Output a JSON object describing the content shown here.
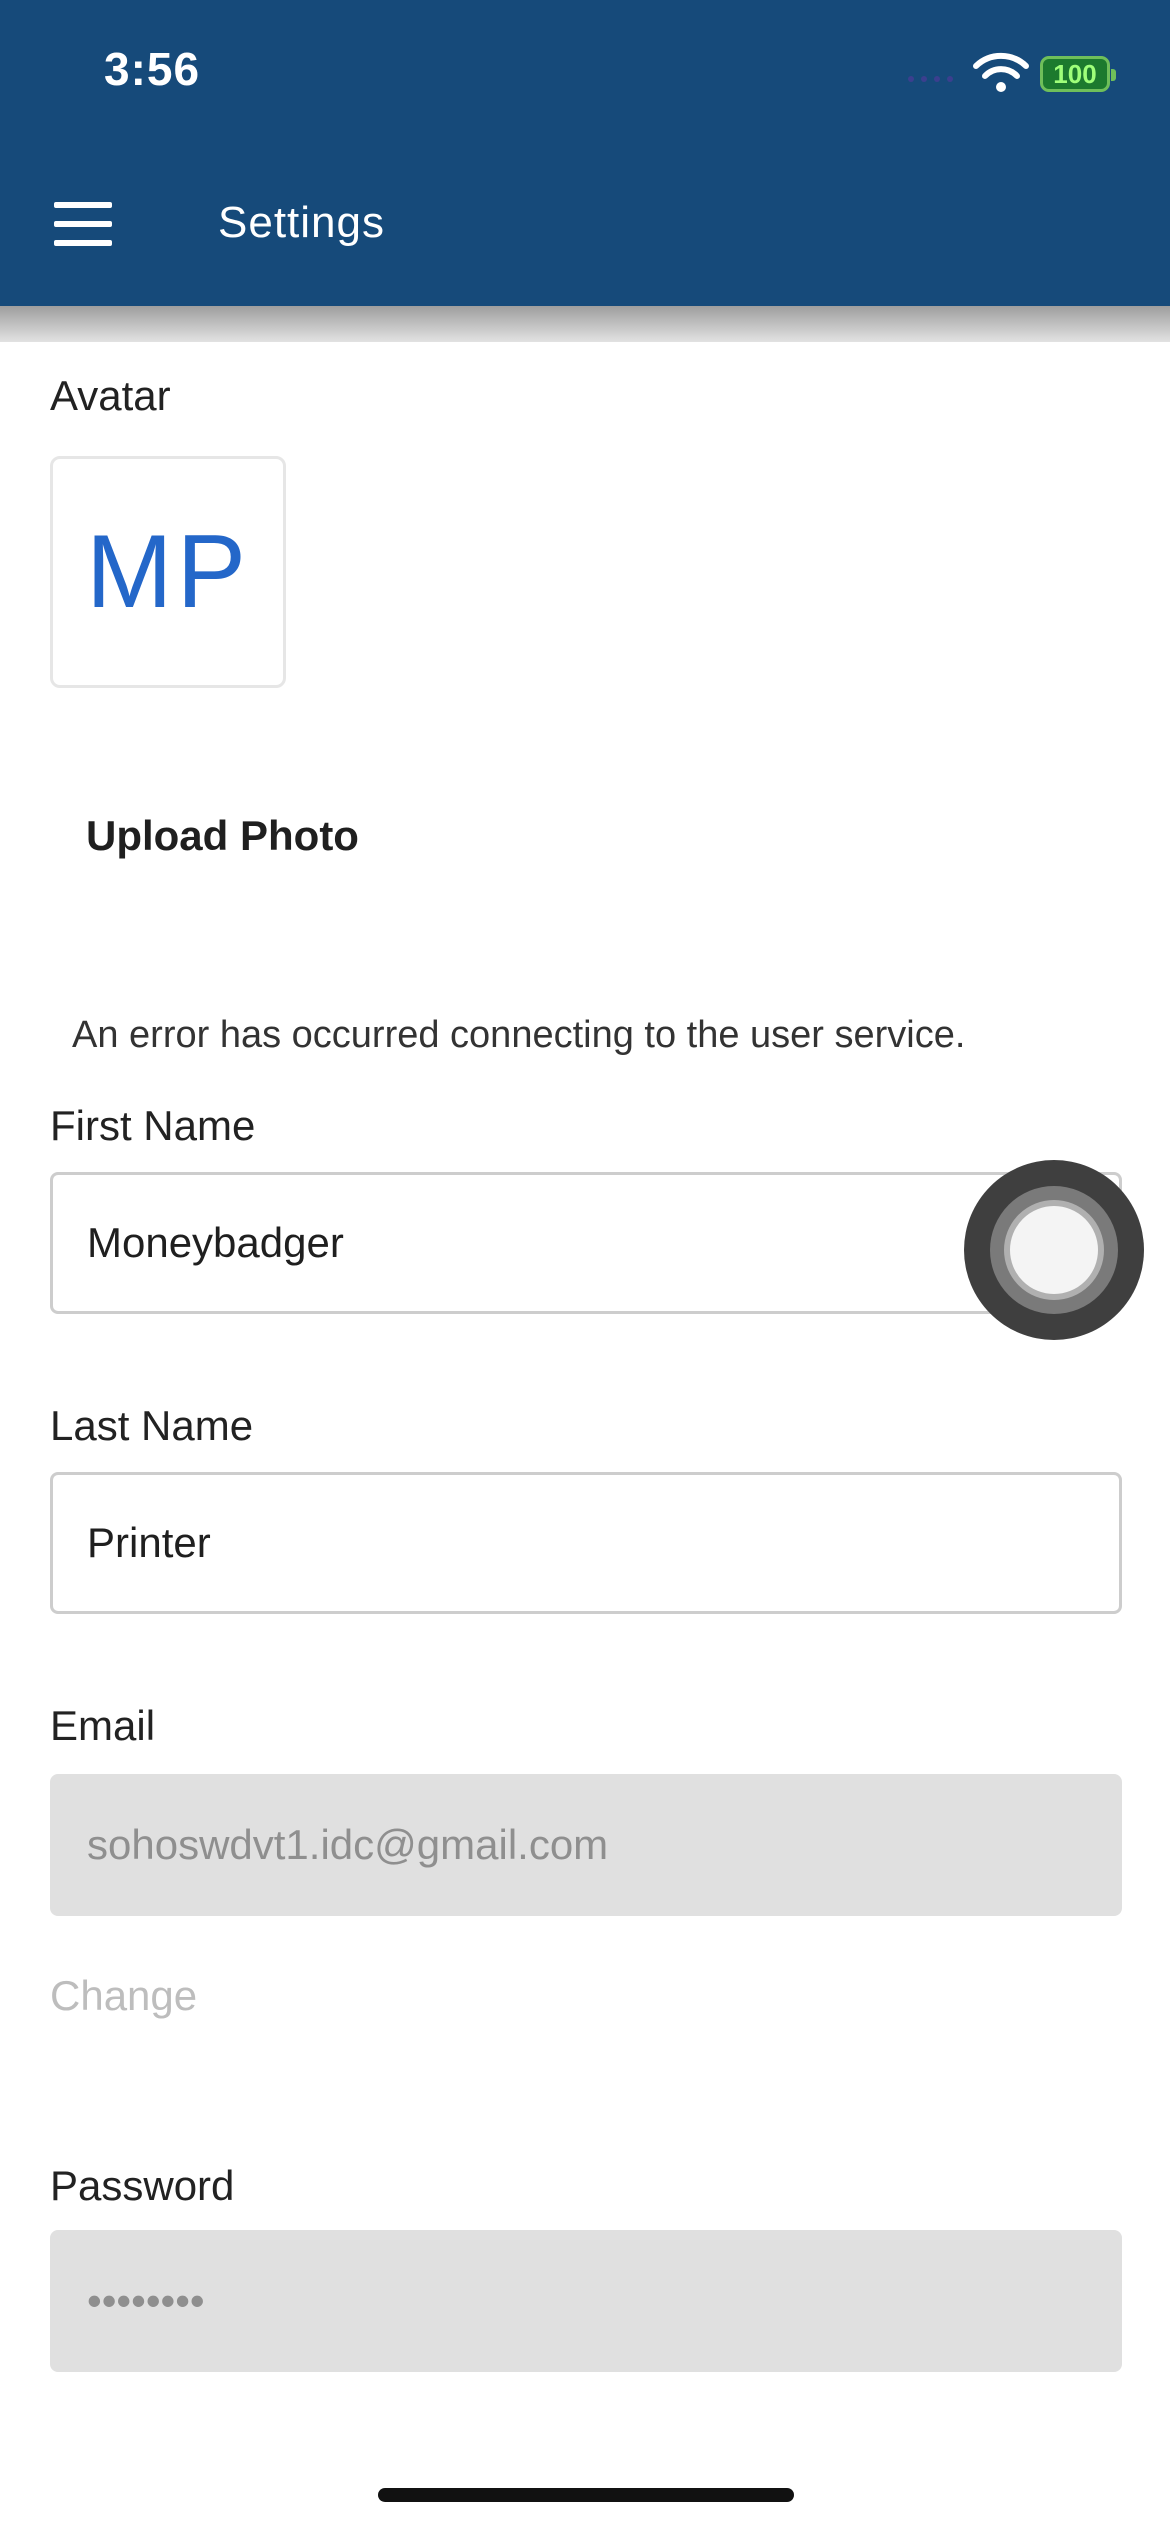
{
  "status_bar": {
    "time": "3:56",
    "battery": "100",
    "icons": [
      "cellular-signal-icon",
      "wifi-icon",
      "battery-icon"
    ]
  },
  "header": {
    "title": "Settings",
    "menu_icon": "hamburger-menu-icon",
    "background_color": "#164a7a"
  },
  "avatar": {
    "label": "Avatar",
    "initials": "MP",
    "initials_color": "#2467c9",
    "upload_label": "Upload Photo"
  },
  "error_message": "An error has occurred connecting to the user service.",
  "form": {
    "first_name": {
      "label": "First Name",
      "value": "Moneybadger"
    },
    "last_name": {
      "label": "Last Name",
      "value": "Printer"
    },
    "email": {
      "label": "Email",
      "value": "sohoswdvt1.idc@gmail.com",
      "change_label": "Change"
    },
    "password": {
      "label": "Password",
      "value": "••••••••"
    }
  }
}
